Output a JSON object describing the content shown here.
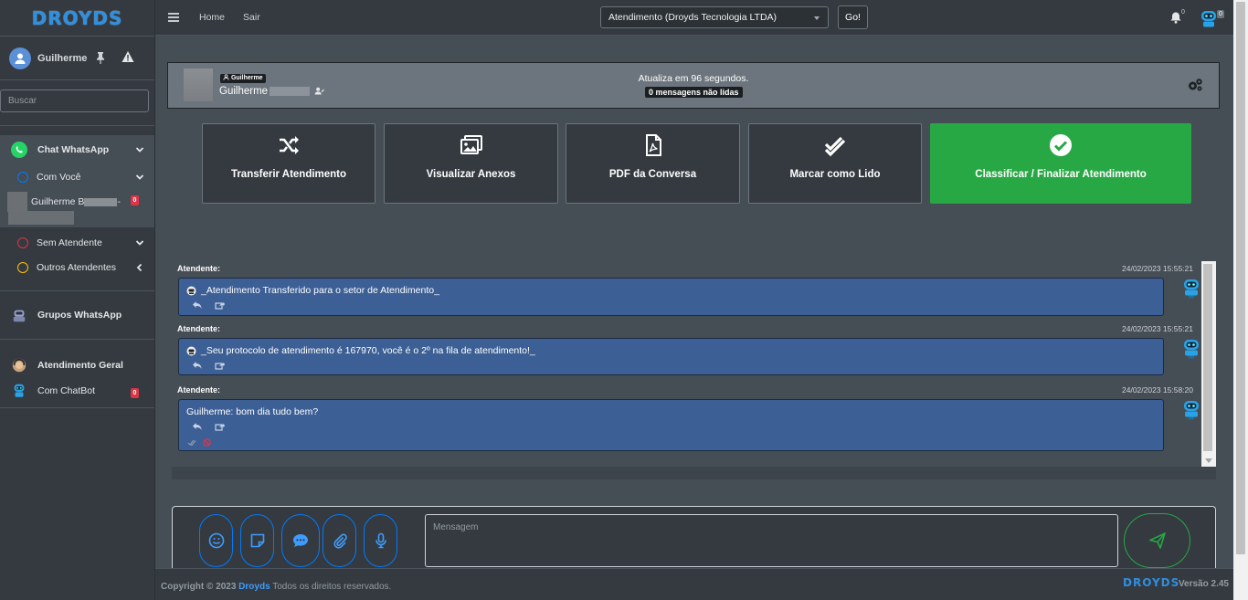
{
  "brand": {
    "logo_text": "DROYDS"
  },
  "sidebar": {
    "user_name": "Guilherme",
    "search_placeholder": "Buscar",
    "sections": {
      "whatsapp": {
        "label": "Chat WhatsApp",
        "sub": [
          {
            "label": "Com Você",
            "color": "#007bff"
          },
          {
            "label": "Sem Atendente",
            "color": "#dc3545"
          },
          {
            "label": "Outros Atendentes",
            "color": "#ffc107"
          }
        ],
        "contact": {
          "name": "Guilherme B",
          "name_suffix": "-",
          "badge": "0"
        }
      },
      "groups": {
        "label": "Grupos WhatsApp"
      },
      "general": {
        "label": "Atendimento Geral"
      },
      "chatbot": {
        "label": "Com ChatBot",
        "badge": "0"
      }
    }
  },
  "topbar": {
    "links": [
      "Home",
      "Sair"
    ],
    "sector_select": "Atendimento (Droyds Tecnologia LTDA)",
    "go_label": "Go!",
    "bell_count": "0",
    "robot_count": "0"
  },
  "card": {
    "tag": "Guilherme",
    "name": "Guilherme",
    "refresh_text": "Atualiza em 96 segundos.",
    "unread_text": "0 mensagens não lidas"
  },
  "actions": [
    {
      "label": "Transferir Atendimento",
      "icon": "shuffle-icon"
    },
    {
      "label": "Visualizar Anexos",
      "icon": "images-icon"
    },
    {
      "label": "PDF da Conversa",
      "icon": "pdf-icon"
    },
    {
      "label": "Marcar como Lido",
      "icon": "double-check-icon"
    },
    {
      "label": "Classificar / Finalizar Atendimento",
      "icon": "check-circle-icon"
    }
  ],
  "messages": [
    {
      "author": "Atendente:",
      "timestamp": "24/02/2023 15:55:21",
      "text": "_Atendimento Transferido para o setor de Atendimento_"
    },
    {
      "author": "Atendente:",
      "timestamp": "24/02/2023 15:55:21",
      "text": "_Seu protocolo de atendimento é 167970, você é o 2º na fila de atendimento!_"
    },
    {
      "author": "Atendente:",
      "timestamp": "24/02/2023 15:58:20",
      "text": "Guilherme: bom dia tudo bem?"
    }
  ],
  "composer": {
    "placeholder": "Mensagem"
  },
  "footer": {
    "copyright_prefix": "Copyright © 2023",
    "brand": "Droyds",
    "rights": "Todos os direitos reservados.",
    "logo_text": "DROYDS",
    "version_label": "Versão",
    "version": "2.45"
  },
  "colors": {
    "accent_green": "#28a745",
    "accent_blue": "#007bff",
    "bubble": "#3c5f95"
  }
}
